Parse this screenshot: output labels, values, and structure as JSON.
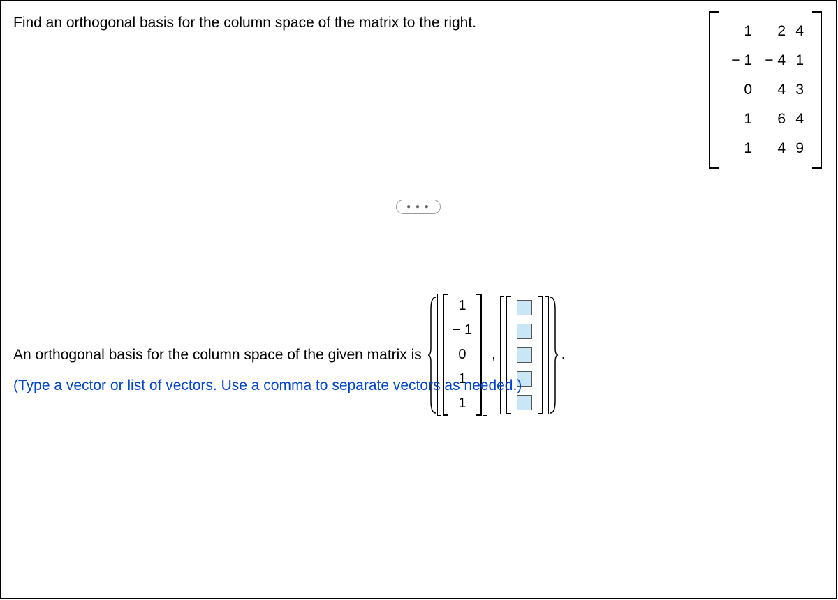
{
  "question": "Find an orthogonal basis for the column space of the matrix to the right.",
  "matrix": {
    "rows": [
      [
        "1",
        "2",
        "4"
      ],
      [
        "− 1",
        "− 4",
        "1"
      ],
      [
        "0",
        "4",
        "3"
      ],
      [
        "1",
        "6",
        "4"
      ],
      [
        "1",
        "4",
        "9"
      ]
    ]
  },
  "answer_prefix": "An orthogonal basis for the column space of the given matrix is",
  "given_vector": [
    "1",
    "− 1",
    "0",
    "1",
    "1"
  ],
  "separator": ",",
  "terminator": ".",
  "hint": "(Type a vector or list of vectors. Use a comma to separate vectors as needed.)",
  "divider_dots": "● ● ●"
}
